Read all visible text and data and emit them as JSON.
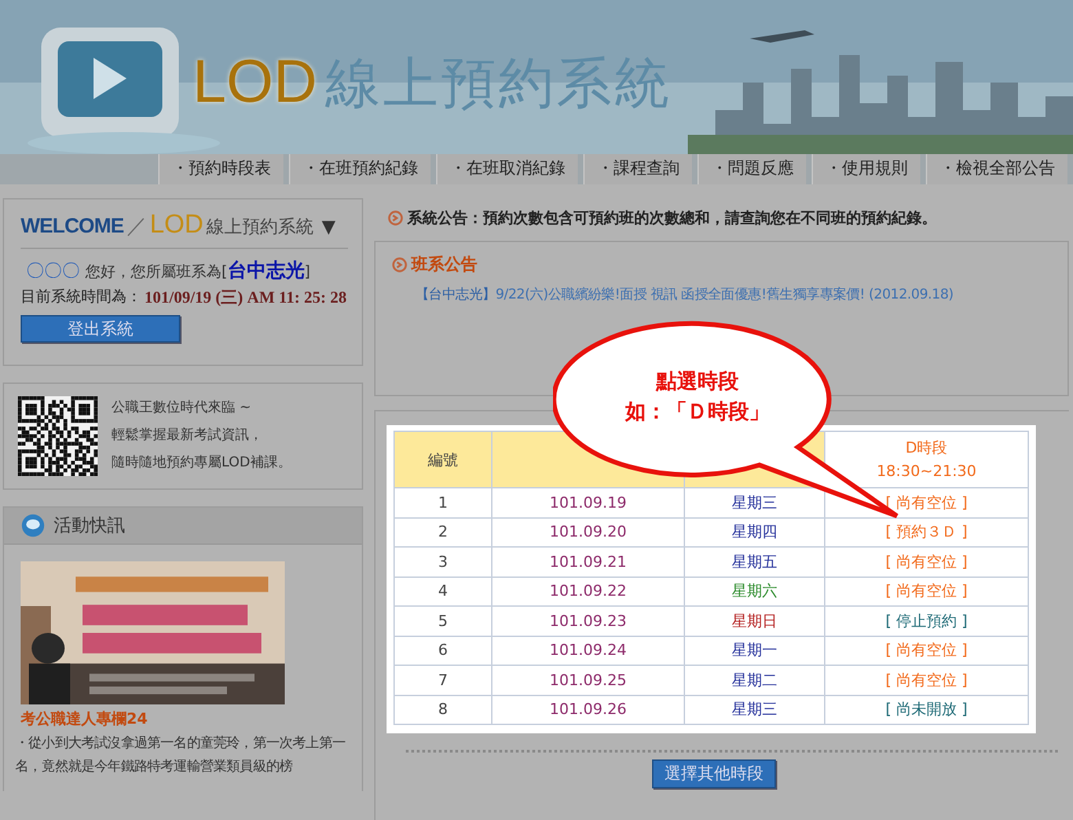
{
  "header": {
    "logo_latin": "LOD",
    "logo_text": "線上預約系統"
  },
  "nav": [
    {
      "label": "・預約時段表"
    },
    {
      "label": "・在班預約紀錄"
    },
    {
      "label": "・在班取消紀錄"
    },
    {
      "label": "・課程查詢"
    },
    {
      "label": "・問題反應"
    },
    {
      "label": "・使用規則"
    },
    {
      "label": "・檢視全部公告"
    }
  ],
  "welcome": {
    "welcome": "WELCOME",
    "slash": "／",
    "lod": "LOD",
    "system": "線上預約系統",
    "toggle": "▼",
    "user": "〇〇〇",
    "greeting": "您好，您所屬班系為[",
    "branch": "台中志光",
    "bracket_close": "]",
    "time_label": "目前系統時間為：",
    "time": "101/09/19 (三) AM 11: 25: 28",
    "logout": "登出系統"
  },
  "qr_lines": [
    "公職王數位時代來臨 ~",
    "輕鬆掌握最新考試資訊，",
    "隨時隨地預約專屬LOD補課。"
  ],
  "activity": {
    "title": "活動快訊",
    "link": "考公職達人專欄24",
    "text": "・從小到大考試沒拿過第一名的童莞玲，第一次考上第一名，竟然就是今年鐵路特考運輸營業類員級的榜"
  },
  "system_notice": "系統公告：預約次數包含可預約班的次數總和，請查詢您在不同班的預約紀錄。",
  "class_notice": {
    "title": "班系公告",
    "items": [
      {
        "branch": "【台中志光】",
        "text": "9/22(六)公職繽紛樂!面授 視訊 函授全面優惠!舊生獨享專案價! (2012.09.18)"
      }
    ]
  },
  "callout": {
    "lines": [
      "點選時段",
      "如：「Ｄ時段」"
    ]
  },
  "table": {
    "columns": [
      {
        "label": "編號"
      },
      {},
      {},
      {
        "label": "D時段",
        "time": "18:30~21:30"
      }
    ],
    "rows": [
      {
        "no": "1",
        "date": "101.09.19",
        "weekday": {
          "text": "星期三",
          "kind": "weekday"
        },
        "status": {
          "text": "[ 尚有空位 ]",
          "kind": "open"
        }
      },
      {
        "no": "2",
        "date": "101.09.20",
        "weekday": {
          "text": "星期四",
          "kind": "weekday"
        },
        "status": {
          "text": "[ 預約３Ｄ ]",
          "kind": "open"
        }
      },
      {
        "no": "3",
        "date": "101.09.21",
        "weekday": {
          "text": "星期五",
          "kind": "weekday"
        },
        "status": {
          "text": "[ 尚有空位 ]",
          "kind": "open"
        }
      },
      {
        "no": "4",
        "date": "101.09.22",
        "weekday": {
          "text": "星期六",
          "kind": "saturday"
        },
        "status": {
          "text": "[ 尚有空位 ]",
          "kind": "open"
        }
      },
      {
        "no": "5",
        "date": "101.09.23",
        "weekday": {
          "text": "星期日",
          "kind": "sunday"
        },
        "status": {
          "text": "[ 停止預約 ]",
          "kind": "closed"
        }
      },
      {
        "no": "6",
        "date": "101.09.24",
        "weekday": {
          "text": "星期一",
          "kind": "weekday"
        },
        "status": {
          "text": "[ 尚有空位 ]",
          "kind": "open"
        }
      },
      {
        "no": "7",
        "date": "101.09.25",
        "weekday": {
          "text": "星期二",
          "kind": "weekday"
        },
        "status": {
          "text": "[ 尚有空位 ]",
          "kind": "open"
        }
      },
      {
        "no": "8",
        "date": "101.09.26",
        "weekday": {
          "text": "星期三",
          "kind": "weekday"
        },
        "status": {
          "text": "[ 尚未開放 ]",
          "kind": "closed"
        }
      }
    ]
  },
  "other_button": "選擇其他時段"
}
